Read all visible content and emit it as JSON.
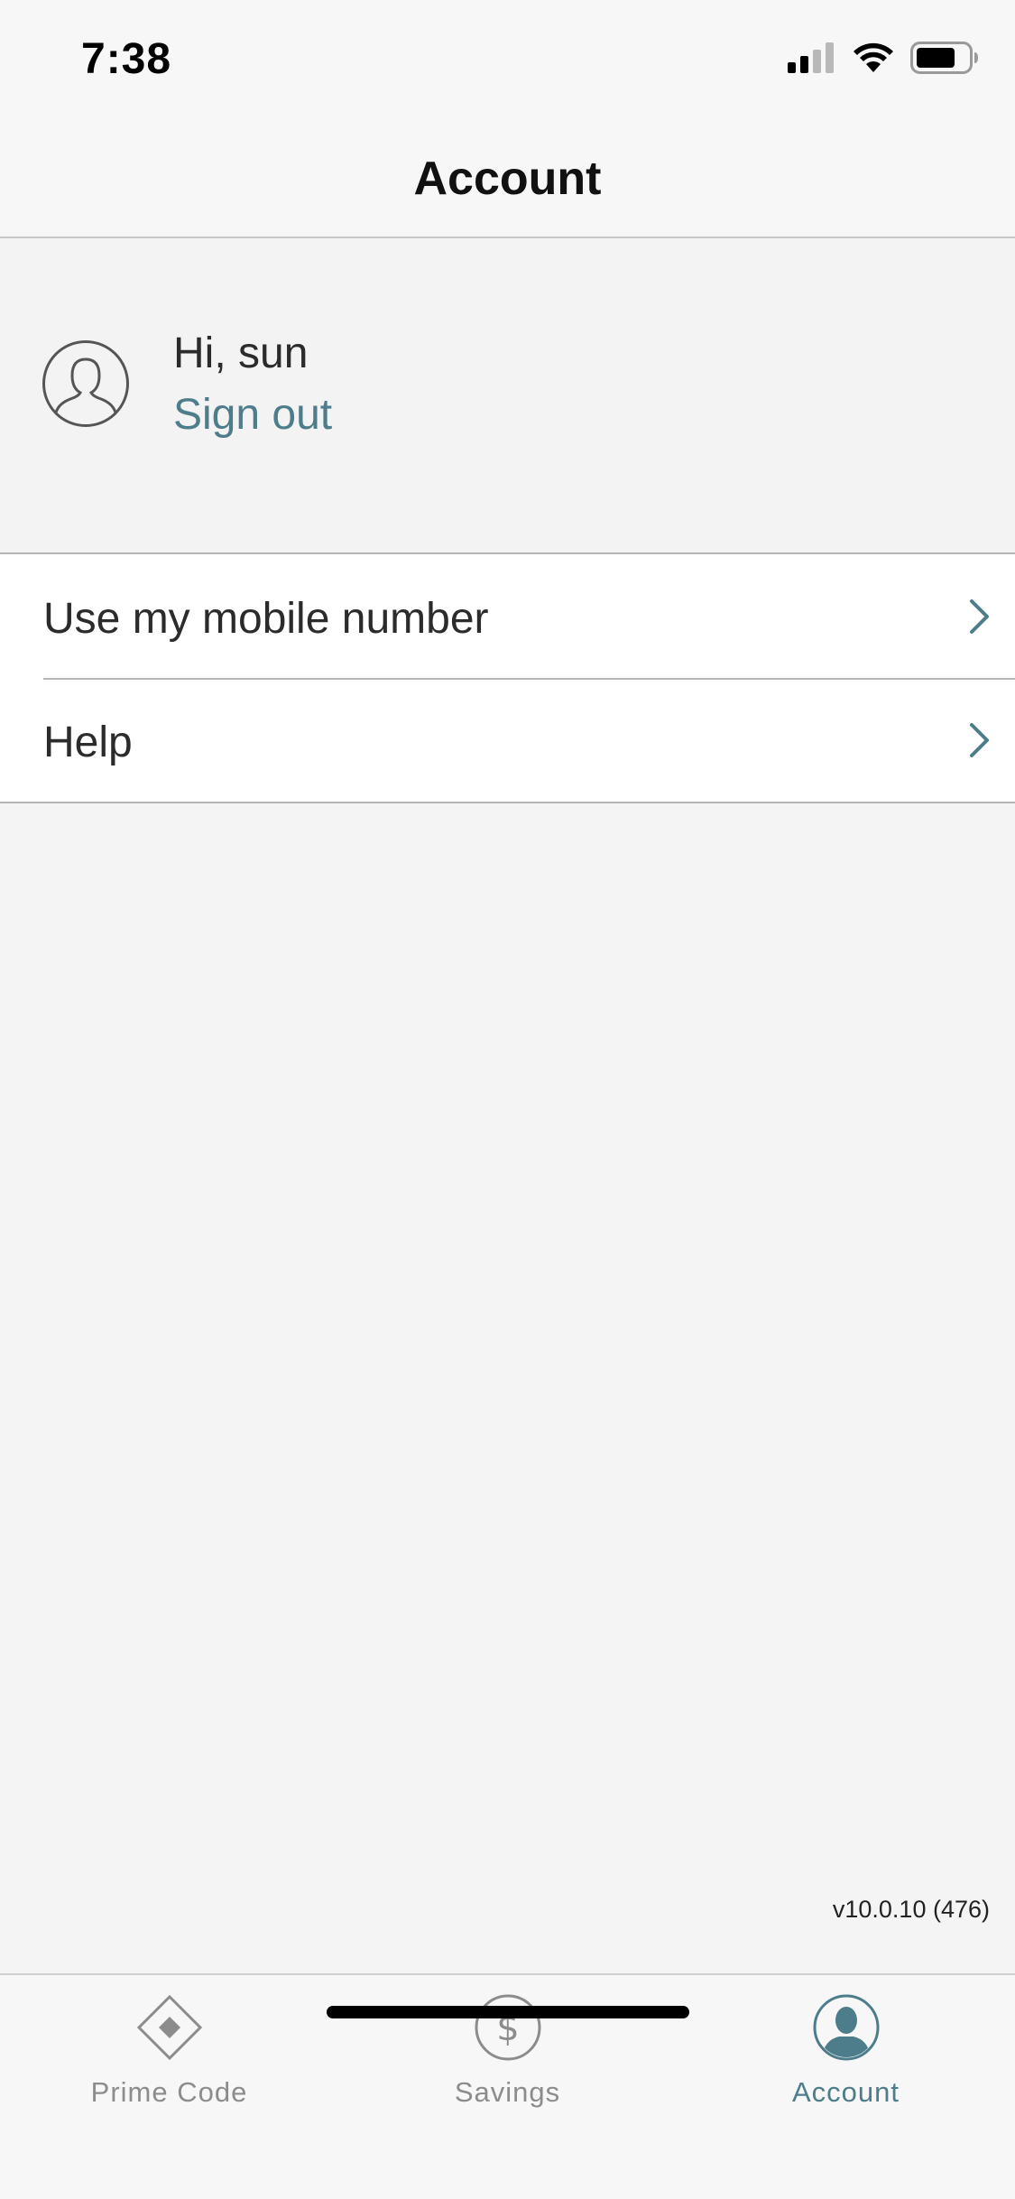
{
  "status_bar": {
    "time": "7:38",
    "icons": [
      "cellular-signal-icon",
      "wifi-icon",
      "battery-icon"
    ]
  },
  "header": {
    "title": "Account"
  },
  "profile": {
    "avatar_icon": "user-avatar-icon",
    "greeting": "Hi, sun",
    "sign_out_label": "Sign out"
  },
  "menu": {
    "items": [
      {
        "label": "Use my mobile number",
        "icon": "chevron-right-icon"
      },
      {
        "label": "Help",
        "icon": "chevron-right-icon"
      }
    ]
  },
  "version": "v10.0.10 (476)",
  "tab_bar": {
    "tabs": [
      {
        "label": "Prime Code",
        "icon": "diamond-icon",
        "active": false
      },
      {
        "label": "Savings",
        "icon": "dollar-icon",
        "active": false
      },
      {
        "label": "Account",
        "icon": "account-icon",
        "active": true
      }
    ]
  },
  "colors": {
    "accent": "#4d7d8a",
    "inactive_tab": "#8c8c8c",
    "background": "#f4f4f4"
  }
}
